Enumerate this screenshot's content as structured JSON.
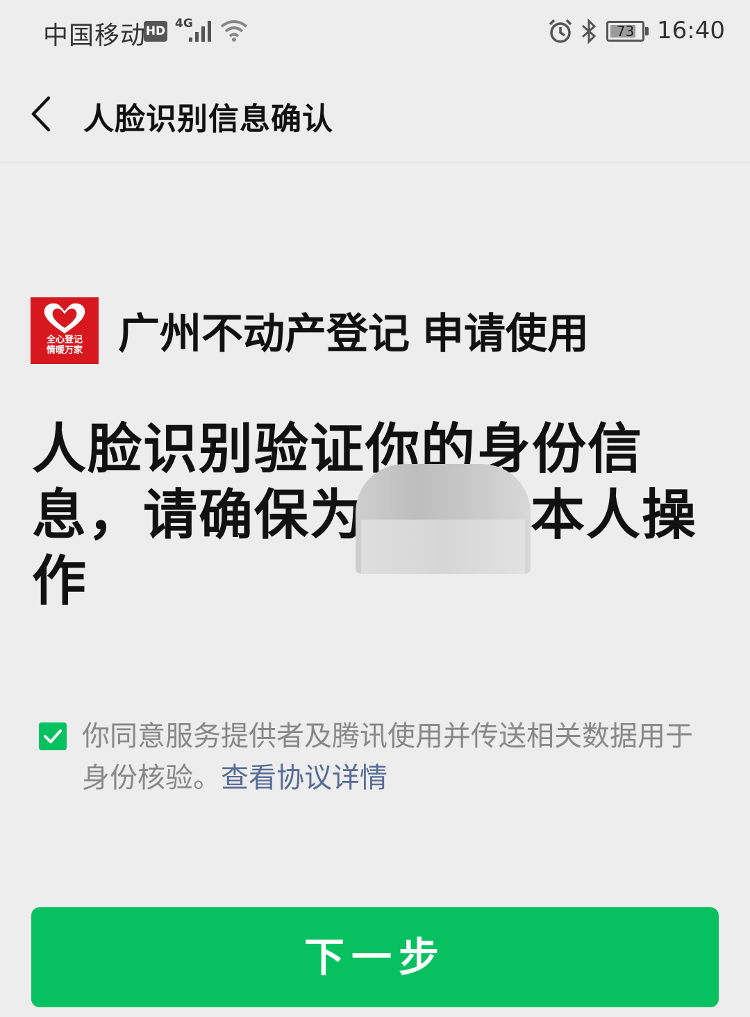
{
  "status_bar": {
    "carrier": "中国移动",
    "hd_label": "HD",
    "network": "4G",
    "battery": "73",
    "time": "16:40",
    "icons": [
      "signal-icon",
      "wifi-icon",
      "alarm-icon",
      "bluetooth-icon",
      "battery-icon"
    ]
  },
  "navbar": {
    "title": "人脸识别信息确认",
    "back_icon": "chevron-left-icon"
  },
  "app": {
    "name": "广州不动产登记",
    "suffix": "申请使用",
    "logo_line1": "全心登记",
    "logo_line2": "情暖万家"
  },
  "heading": {
    "line1": "人脸识别验证你的身份信",
    "line2": "息，请确保为",
    "line2_end": "本人操",
    "line3": "作"
  },
  "agreement": {
    "checked": true,
    "text": "你同意服务提供者及腾讯使用并传送相关数据用于身份核验。",
    "link": "查看协议详情"
  },
  "actions": {
    "next_label": "下一步"
  },
  "colors": {
    "accent": "#07c160",
    "link": "#576b95",
    "logo_red": "#d7181f",
    "background": "#ededed"
  }
}
